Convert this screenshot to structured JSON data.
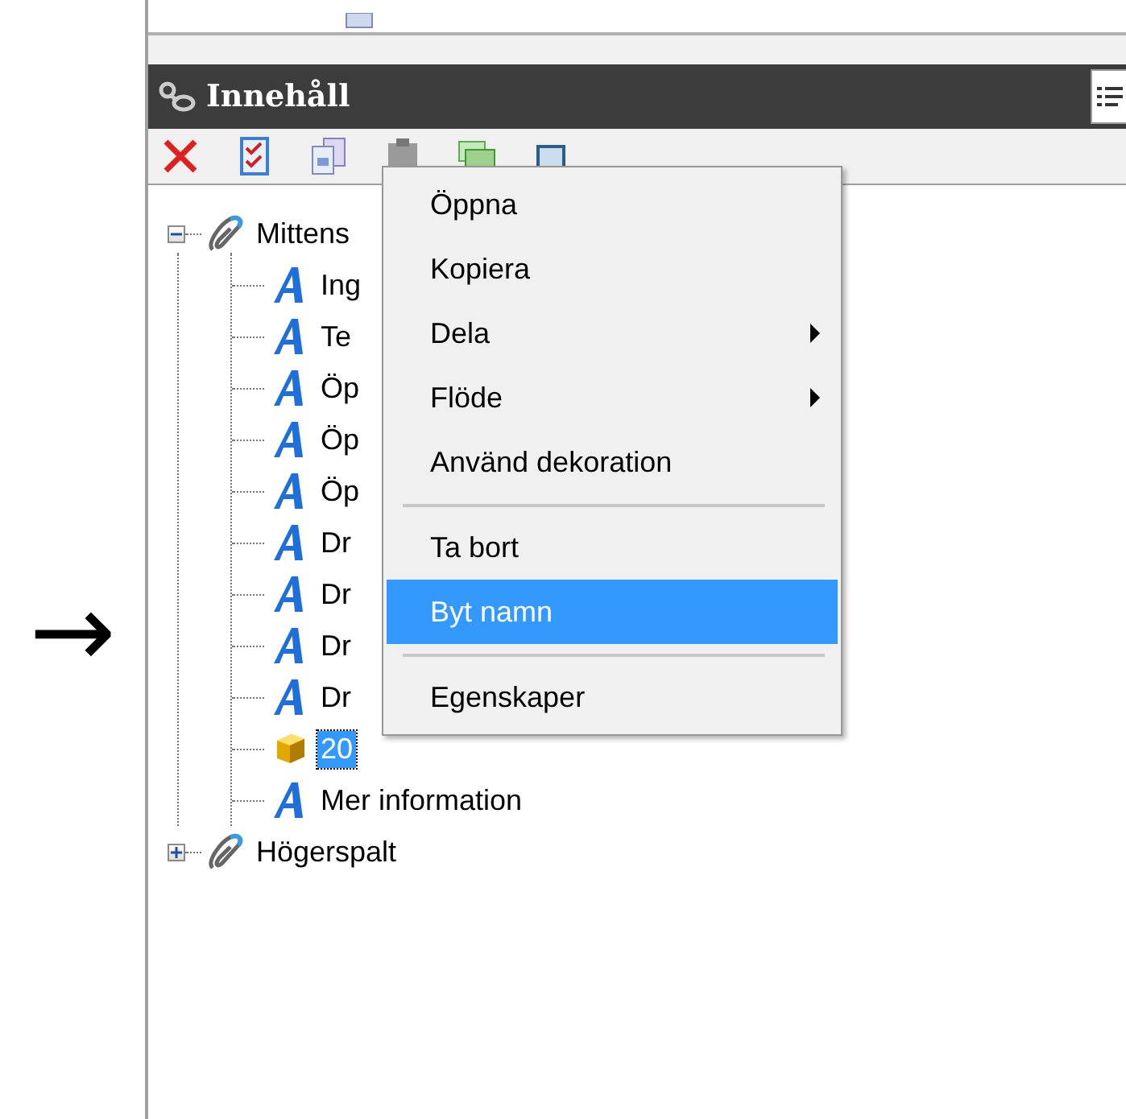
{
  "arrow": {
    "glyph": "→"
  },
  "panel": {
    "title": "Innehåll"
  },
  "tree": [
    {
      "label": "Mittens",
      "expanded": true,
      "selected": false,
      "children": [
        {
          "kind": "text",
          "label": "Ing",
          "selected": false
        },
        {
          "kind": "text",
          "label": "Te",
          "selected": false
        },
        {
          "kind": "text",
          "label": "Öp",
          "selected": false
        },
        {
          "kind": "text",
          "label": "Öp",
          "selected": false
        },
        {
          "kind": "text",
          "label": "Öp",
          "selected": false
        },
        {
          "kind": "text",
          "label": "Dr",
          "selected": false
        },
        {
          "kind": "text",
          "label": "Dr",
          "selected": false
        },
        {
          "kind": "text",
          "label": "Dr",
          "selected": false
        },
        {
          "kind": "text",
          "label": "Dr",
          "selected": false
        },
        {
          "kind": "block",
          "label": "20",
          "selected": true
        },
        {
          "kind": "text",
          "label": "Mer information",
          "selected": false
        }
      ]
    },
    {
      "label": "Högerspalt",
      "expanded": false,
      "selected": false
    }
  ],
  "context_menu": {
    "groups": [
      [
        {
          "label": "Öppna",
          "submenu": false,
          "selected": false
        },
        {
          "label": "Kopiera",
          "submenu": false,
          "selected": false
        },
        {
          "label": "Dela",
          "submenu": true,
          "selected": false
        },
        {
          "label": "Flöde",
          "submenu": true,
          "selected": false
        },
        {
          "label": "Använd dekoration",
          "submenu": false,
          "selected": false
        }
      ],
      [
        {
          "label": "Ta bort",
          "submenu": false,
          "selected": false
        },
        {
          "label": "Byt namn",
          "submenu": false,
          "selected": true
        }
      ],
      [
        {
          "label": "Egenskaper",
          "submenu": false,
          "selected": false
        }
      ]
    ]
  }
}
